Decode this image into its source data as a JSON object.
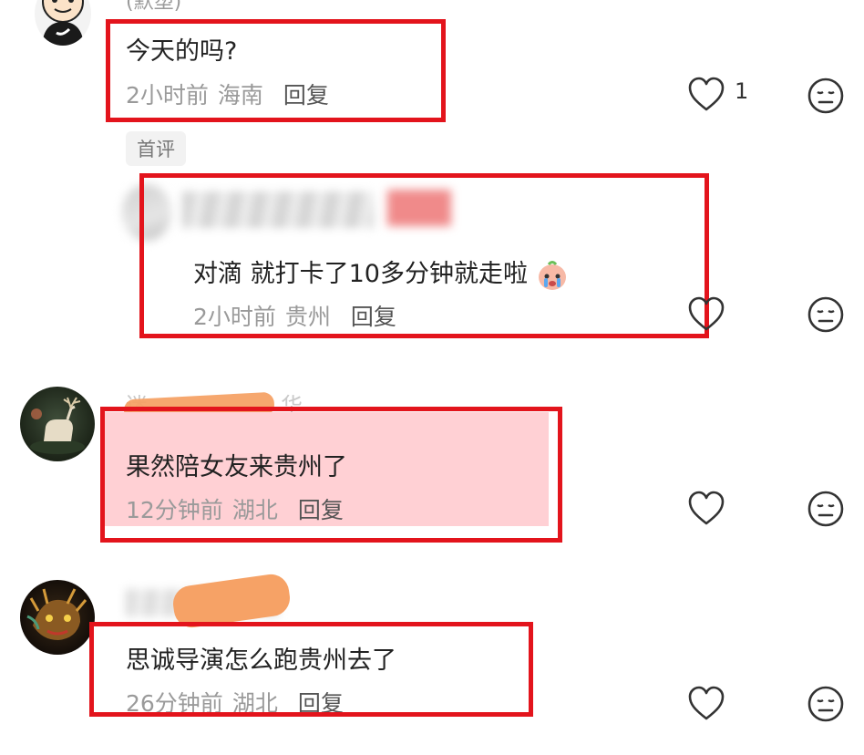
{
  "comments": [
    {
      "author": "(默塑)",
      "text": "今天的吗?",
      "time": "2小时前",
      "location": "海南",
      "reply_label": "回复",
      "likes": "1",
      "tag": "首评"
    },
    {
      "text": "对滴 就打卡了10多分钟就走啦",
      "time": "2小时前",
      "location": "贵州",
      "reply_label": "回复"
    },
    {
      "author": "迷",
      "author_tail": "华",
      "text": "果然陪女友来贵州了",
      "time": "12分钟前",
      "location": "湖北",
      "reply_label": "回复"
    },
    {
      "text": "思诚导演怎么跑贵州去了",
      "time": "26分钟前",
      "location": "湖北",
      "reply_label": "回复"
    }
  ],
  "icons": {
    "like": "heart-icon",
    "dislike": "meh-face-icon"
  },
  "colors": {
    "highlight_box": "#e3141c",
    "pink_highlight": "#ffd0d4",
    "scribble_orange": "#f6a266"
  }
}
